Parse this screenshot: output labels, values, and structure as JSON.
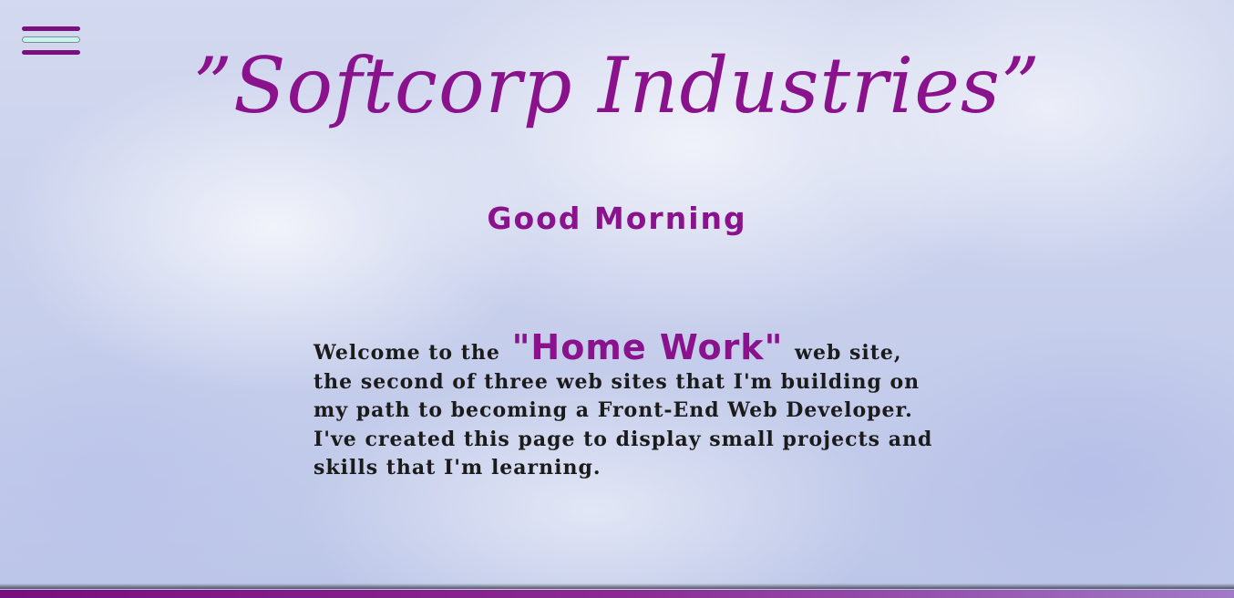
{
  "menu": {
    "icon": "hamburger-menu-icon",
    "colors": {
      "bar": "#7a0f7e",
      "middle": "#c9f3ec"
    }
  },
  "header": {
    "title": "”Softcorp Industries”",
    "greeting": "Good Morning"
  },
  "intro": {
    "lead": "Welcome to the ",
    "highlight": "\"Home Work\"",
    "body": " web site, the second of three web sites that I'm building on my path to becoming a Front-End Web Developer. I've created this page to display small projects and skills that I'm learning."
  },
  "colors": {
    "accent": "#8a128c",
    "text": "#1b1b1b",
    "background": "#c8d0ec"
  }
}
